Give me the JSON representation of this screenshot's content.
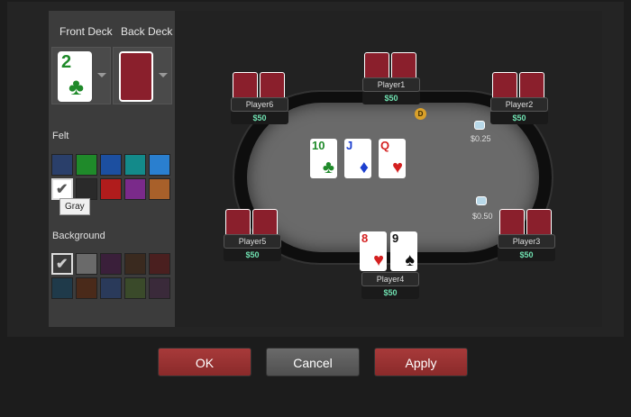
{
  "deck": {
    "front_label": "Front Deck",
    "back_label": "Back Deck",
    "front_preview": {
      "rank": "2",
      "suit": "♣"
    }
  },
  "felt": {
    "label": "Felt",
    "tooltip": "Gray",
    "swatches": [
      "#2a3f6a",
      "#1f8a2a",
      "#1c4fa0",
      "#138a8a",
      "#2a7fcf",
      "#ffffff",
      "#2a2a2a",
      "#b01c1c",
      "#7a2a8a",
      "#a8602a"
    ]
  },
  "background": {
    "label": "Background",
    "swatches": [
      "#3a3a3a",
      "#6a6a6a",
      "#3a1f3a",
      "#3a2a1f",
      "#4a1f1f",
      "#1f3a4a",
      "#4a2a1a",
      "#2a3a5a",
      "#3a4a2a",
      "#3a2a3a"
    ]
  },
  "players": [
    {
      "name": "Player1",
      "stack": "$50"
    },
    {
      "name": "Player2",
      "stack": "$50"
    },
    {
      "name": "Player3",
      "stack": "$50"
    },
    {
      "name": "Player4",
      "stack": "$50"
    },
    {
      "name": "Player5",
      "stack": "$50"
    },
    {
      "name": "Player6",
      "stack": "$50"
    }
  ],
  "table": {
    "dealer": "D",
    "bet_small": "$0.25",
    "bet_big": "$0.50",
    "board": [
      {
        "rank": "10",
        "suit": "♣",
        "color": "#1f8a2a"
      },
      {
        "rank": "J",
        "suit": "♦",
        "color": "#1c3fcf"
      },
      {
        "rank": "Q",
        "suit": "♥",
        "color": "#d42020"
      }
    ],
    "hero_cards": [
      {
        "rank": "8",
        "suit": "♥",
        "color": "#d42020"
      },
      {
        "rank": "9",
        "suit": "♠",
        "color": "#111111"
      }
    ]
  },
  "buttons": {
    "ok": "OK",
    "cancel": "Cancel",
    "apply": "Apply"
  }
}
